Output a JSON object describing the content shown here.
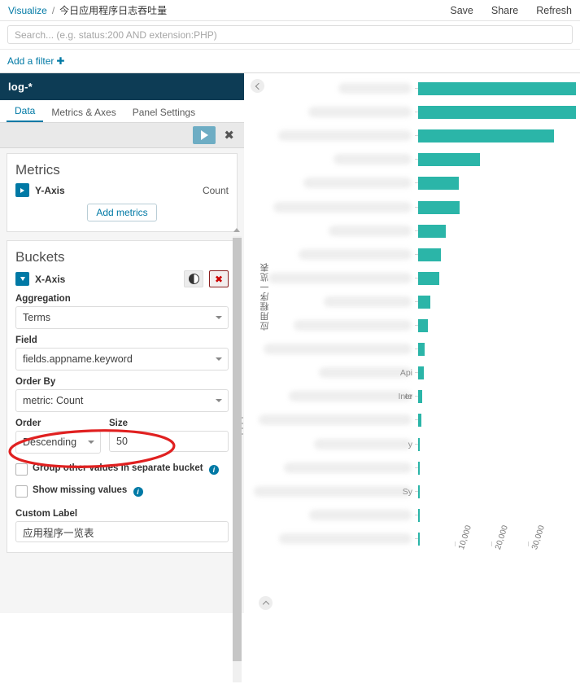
{
  "topbar": {
    "breadcrumb_root": "Visualize",
    "breadcrumb_sep": "/",
    "breadcrumb_current": "今日应用程序日志吞吐量",
    "actions": [
      {
        "label": "Save",
        "name": "save-button"
      },
      {
        "label": "Share",
        "name": "share-button"
      },
      {
        "label": "Refresh",
        "name": "refresh-button"
      }
    ]
  },
  "query": {
    "value": "",
    "placeholder": "Search... (e.g. status:200 AND extension:PHP)"
  },
  "filters": {
    "add_filter_label": "Add a filter",
    "plus_glyph": "✚"
  },
  "editor": {
    "index_pattern": "log-*",
    "tabs": [
      {
        "label": "Data",
        "active": true
      },
      {
        "label": "Metrics & Axes",
        "active": false
      },
      {
        "label": "Panel Settings",
        "active": false
      }
    ],
    "apply_title": "Apply changes",
    "discard_glyph": "✖",
    "metrics": {
      "title": "Metrics",
      "y_axis_label": "Y-Axis",
      "y_axis_value": "Count",
      "add_metrics_label": "Add metrics"
    },
    "buckets": {
      "title": "Buckets",
      "x_axis_label": "X-Axis",
      "aggregation_label": "Aggregation",
      "aggregation_value": "Terms",
      "field_label": "Field",
      "field_value": "fields.appname.keyword",
      "order_by_label": "Order By",
      "order_by_value": "metric: Count",
      "order_label": "Order",
      "order_value": "Descending",
      "size_label": "Size",
      "size_value": "50",
      "group_other_label": "Group other values in separate bucket",
      "show_missing_label": "Show missing values",
      "custom_label_label": "Custom Label",
      "custom_label_value": "应用程序一览表",
      "info_glyph": "i"
    },
    "annotation": {
      "shape": "red-ellipse",
      "color": "#e02020",
      "target": "field-select"
    }
  },
  "chart_data": {
    "type": "bar",
    "orientation": "horizontal",
    "title": "",
    "xlabel": "",
    "ylabel": "应用程序一览表",
    "xlim": [
      0,
      33000
    ],
    "grid": false,
    "legend": false,
    "xticks": [
      "10,000",
      "20,000",
      "30,000"
    ],
    "xtick_values": [
      10000,
      20000,
      30000
    ],
    "bar_color": "#2bb5a8",
    "categories": [
      "",
      "",
      "",
      "",
      "",
      "",
      "",
      "",
      "",
      "",
      "",
      "",
      "",
      "",
      "",
      "",
      "",
      "",
      "",
      ""
    ],
    "category_labels_redacted": true,
    "partial_labels": [
      {
        "index": 12,
        "text": "Api"
      },
      {
        "index": 13,
        "text": "Inte"
      },
      {
        "index": 13,
        "text": "er"
      },
      {
        "index": 15,
        "text": "y"
      },
      {
        "index": 17,
        "text": "Sy"
      }
    ],
    "values": [
      43000,
      43000,
      37200,
      16800,
      11200,
      11400,
      7600,
      6200,
      5800,
      3300,
      2700,
      1700,
      1450,
      1150,
      800,
      420,
      260,
      170,
      110,
      60
    ],
    "note": "Top two bars extend beyond the visible plot width; values estimated from axis scale."
  }
}
